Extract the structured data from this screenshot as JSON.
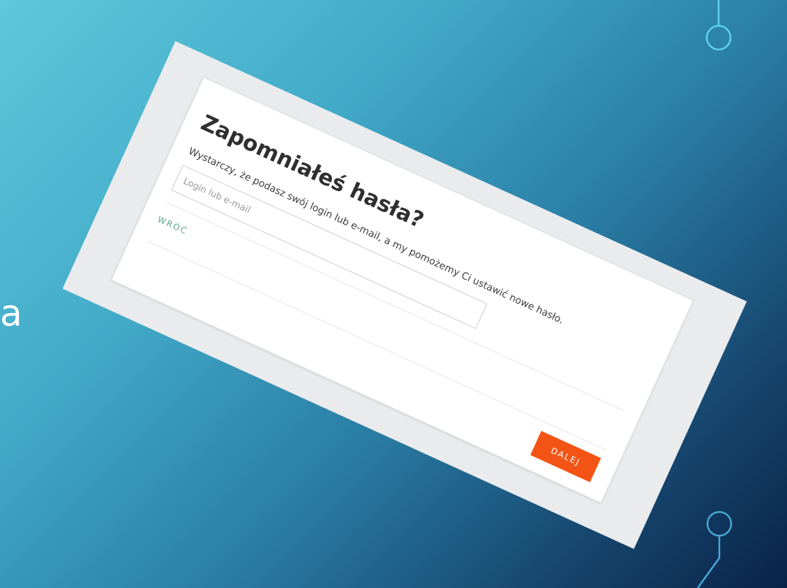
{
  "slide": {
    "partial_letter": "a"
  },
  "form": {
    "title": "Zapomniałeś hasła?",
    "subtitle": "Wystarczy, że podasz swój login lub e-mail, a my pomożemy Ci ustawić nowe hasło.",
    "login_placeholder": "Login lub e-mail",
    "login_value": "",
    "back_label": "WRÓĆ",
    "next_label": "DALEJ"
  },
  "colors": {
    "accent_orange": "#f35416",
    "link_green": "#5ea78d",
    "background_light": "#5ec8dc",
    "background_dark": "#0a2248"
  }
}
